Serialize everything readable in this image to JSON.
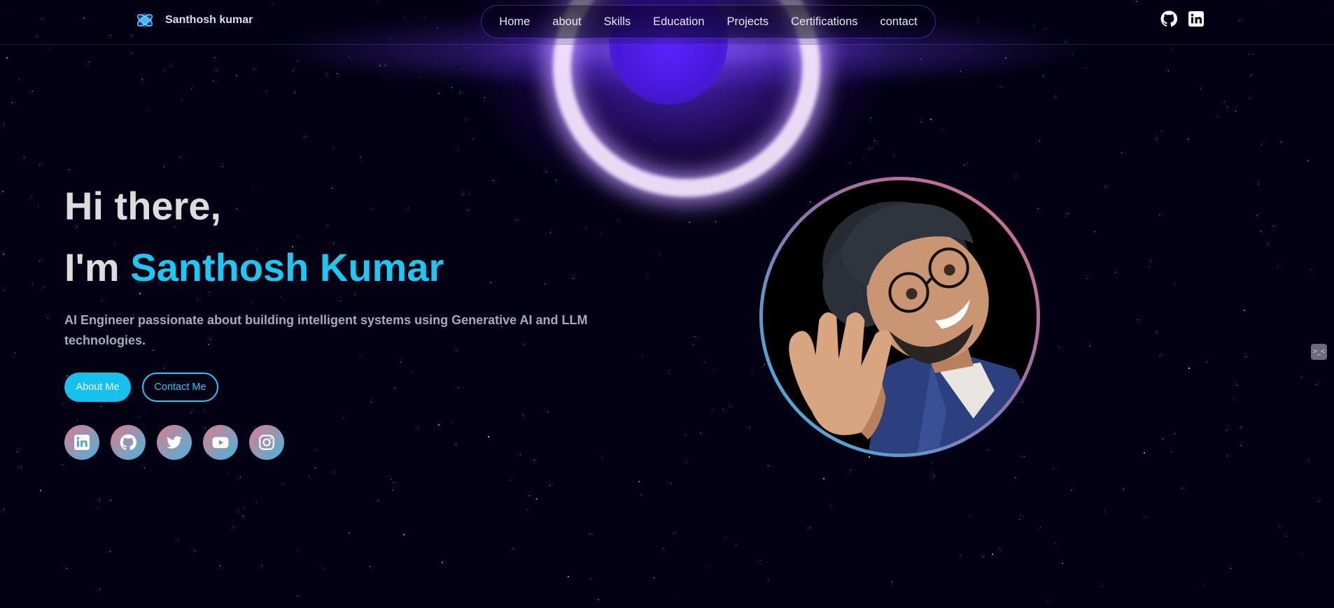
{
  "header": {
    "brand_name": "Santhosh kumar",
    "nav": [
      "Home",
      "about",
      "Skills",
      "Education",
      "Projects",
      "Certifications",
      "contact"
    ],
    "icons": [
      "github-icon",
      "linkedin-icon"
    ]
  },
  "hero": {
    "greeting": "Hi there,",
    "intro_prefix": "I'm ",
    "intro_name": "Santhosh Kumar",
    "tagline": "AI Engineer passionate about building intelligent systems using Generative AI and LLM technologies.",
    "about_button": "About Me",
    "contact_button": "Contact Me",
    "socials": [
      "linkedin-icon",
      "github-icon",
      "twitter-icon",
      "youtube-icon",
      "instagram-icon"
    ]
  },
  "colors": {
    "background": "#030014",
    "accent": "#1cc8f0",
    "glow": "#7042f8",
    "social_gradient": [
      "#e07a8e",
      "#44b6dc"
    ]
  }
}
